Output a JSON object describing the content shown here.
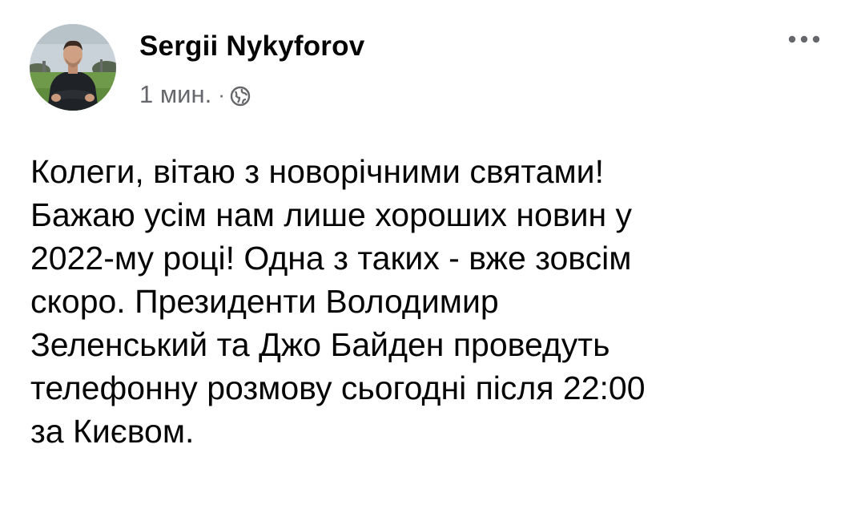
{
  "post": {
    "author_name": "Sergii Nykyforov",
    "timestamp": "1 мин.",
    "separator": "·",
    "privacy_icon": "globe-icon",
    "more_icon": "more-options-icon",
    "avatar_icon": "profile-photo",
    "text": "Колеги, вітаю з новорічними святами!\nБажаю усім нам лише хороших новин у\n2022-му році! Одна з таких - вже зовсім\nскоро. Президенти Володимир\nЗеленський та Джо Байден проведуть\nтелефонну розмову сьогодні після 22:00\nза Києвом."
  },
  "colors": {
    "text_primary": "#050505",
    "text_secondary": "#65676b",
    "background": "#ffffff"
  }
}
